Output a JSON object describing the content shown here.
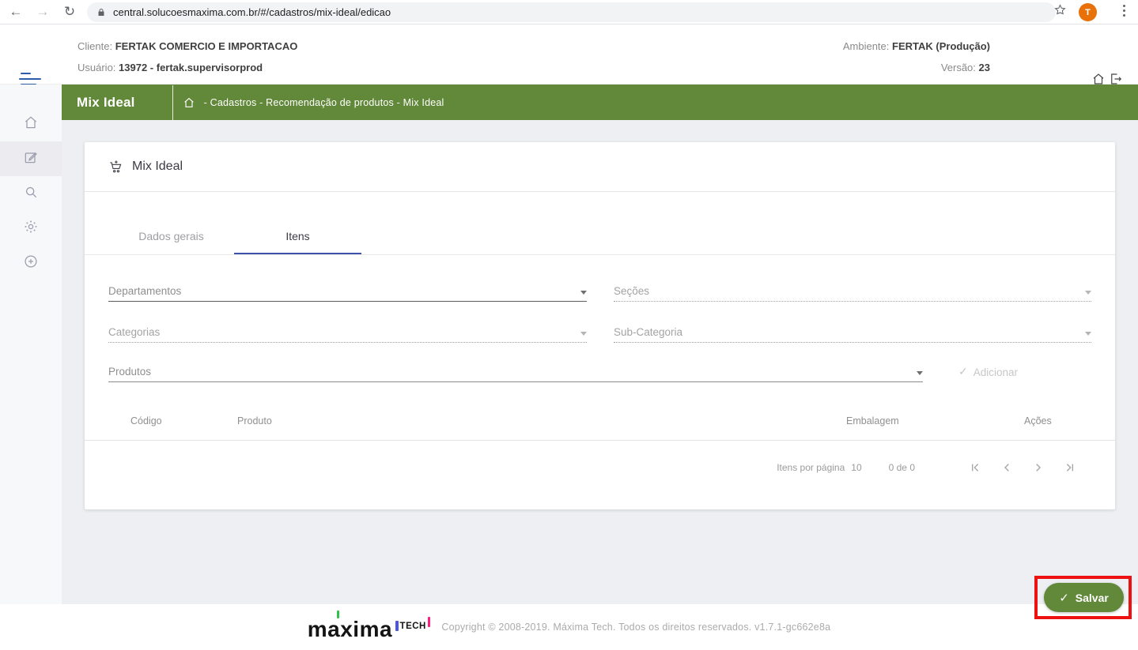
{
  "browser": {
    "url": "central.solucoesmaxima.com.br/#/cadastros/mix-ideal/edicao",
    "avatar_letter": "T"
  },
  "header": {
    "client_label": "Cliente:",
    "client_value": "FERTAK COMERCIO E IMPORTACAO",
    "user_label": "Usuário:",
    "user_value": "13972 - fertak.supervisorprod",
    "env_label": "Ambiente:",
    "env_value": "FERTAK (Produção)",
    "version_label": "Versão:",
    "version_value": "23"
  },
  "titlebar": {
    "title": "Mix Ideal",
    "breadcrumb": "- Cadastros - Recomendação de produtos - Mix Ideal"
  },
  "sidebar": {
    "items": [
      {
        "icon": "home-icon",
        "active": false
      },
      {
        "icon": "edit-icon",
        "active": true
      },
      {
        "icon": "search-icon",
        "active": false
      },
      {
        "icon": "settings-icon",
        "active": false
      },
      {
        "icon": "add-circle-icon",
        "active": false
      }
    ]
  },
  "card": {
    "title": "Mix Ideal",
    "tabs": [
      {
        "label": "Dados gerais",
        "active": false
      },
      {
        "label": "Itens",
        "active": true
      }
    ],
    "fields": {
      "departamentos": {
        "label": "Departamentos",
        "enabled": true
      },
      "secoes": {
        "label": "Seções",
        "enabled": false
      },
      "categorias": {
        "label": "Categorias",
        "enabled": false
      },
      "subcategoria": {
        "label": "Sub-Categoria",
        "enabled": false
      },
      "produtos": {
        "label": "Produtos",
        "enabled": true
      }
    },
    "add_button_label": "Adicionar",
    "table": {
      "columns": [
        "Código",
        "Produto",
        "Embalagem",
        "Ações"
      ],
      "rows": []
    },
    "pagination": {
      "items_per_page_label": "Itens por página",
      "items_per_page": "10",
      "range_label": "0 de 0"
    }
  },
  "save_button_label": "Salvar",
  "footer": {
    "logo_main": "maxima",
    "logo_sub": "TECH",
    "copyright": "Copyright © 2008-2019. Máxima Tech. Todos os direitos reservados. v1.7.1-gc662e8a"
  },
  "colors": {
    "primary_green": "#62883a",
    "tab_accent": "#3d52a8",
    "highlight_red": "#ee1111",
    "avatar_orange": "#e8710a"
  }
}
